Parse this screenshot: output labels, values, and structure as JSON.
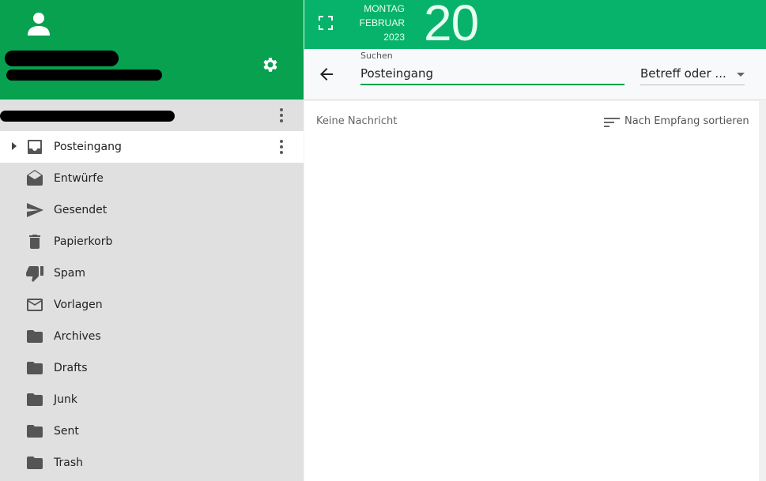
{
  "header": {
    "settings_icon": "gear-icon",
    "avatar_icon": "person-icon",
    "brand_color": "#07a14f"
  },
  "folders": [
    {
      "label": "Posteingang",
      "icon": "inbox-icon",
      "active": true
    },
    {
      "label": "Entwürfe",
      "icon": "drafts-icon"
    },
    {
      "label": "Gesendet",
      "icon": "send-icon"
    },
    {
      "label": "Papierkorb",
      "icon": "trash-icon"
    },
    {
      "label": "Spam",
      "icon": "thumb-down-icon"
    },
    {
      "label": "Vorlagen",
      "icon": "mail-icon"
    },
    {
      "label": "Archives",
      "icon": "folder-icon"
    },
    {
      "label": "Drafts",
      "icon": "folder-icon"
    },
    {
      "label": "Junk",
      "icon": "folder-icon"
    },
    {
      "label": "Sent",
      "icon": "folder-icon"
    },
    {
      "label": "Trash",
      "icon": "folder-icon"
    }
  ],
  "date": {
    "weekday": "MONTAG",
    "month": "FEBRUAR",
    "year": "2023",
    "day": "20"
  },
  "search": {
    "label": "Suchen",
    "value": "Posteingang",
    "scope": "Betreff oder ..."
  },
  "list": {
    "empty_text": "Keine Nachricht",
    "sort_label": "Nach Empfang sortieren"
  }
}
